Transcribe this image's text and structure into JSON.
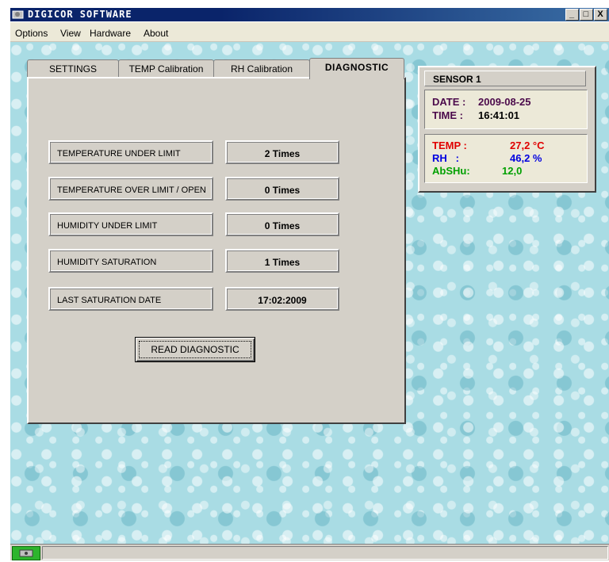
{
  "window": {
    "title": "DIGICOR SOFTWARE",
    "buttons": {
      "minimize": "_",
      "maximize": "□",
      "close": "X"
    }
  },
  "menu": [
    "Options",
    "View",
    "Hardware",
    "About"
  ],
  "tabs": [
    {
      "label": "SETTINGS",
      "active": false
    },
    {
      "label": "TEMP Calibration",
      "active": false
    },
    {
      "label": "RH Calibration",
      "active": false
    },
    {
      "label": "DIAGNOSTIC",
      "active": true
    }
  ],
  "diagnostic": {
    "rows": [
      {
        "label": "TEMPERATURE UNDER LIMIT",
        "value": "2 Times"
      },
      {
        "label": "TEMPERATURE OVER LIMIT / OPEN",
        "value": "0 Times"
      },
      {
        "label": "HUMIDITY UNDER LIMIT",
        "value": "0 Times"
      },
      {
        "label": "HUMIDITY SATURATION",
        "value": "1 Times"
      },
      {
        "label": "LAST SATURATION DATE",
        "value": "17:02:2009"
      }
    ],
    "read_button": "READ DIAGNOSTIC"
  },
  "sensor": {
    "title": "SENSOR 1",
    "date_label": "DATE :",
    "date_value": "2009-08-25",
    "time_label": "TIME :",
    "time_value": "16:41:01",
    "temp_label": "TEMP :",
    "temp_value": "27,2 °C",
    "rh_label": "RH   :",
    "rh_value": "46,2 %",
    "abshu_label": "AbSHu:",
    "abshu_value": "12,0"
  },
  "colors": {
    "title_bar": "#0a246a",
    "date_time": "#4b0a4b",
    "temp": "#e00000",
    "rh": "#0000e0",
    "abshu": "#00a000",
    "status_icon": "#2db52d",
    "background": "#a9dce4"
  },
  "icons": {
    "app": "sensor-chip-icon",
    "status": "device-status-icon"
  }
}
